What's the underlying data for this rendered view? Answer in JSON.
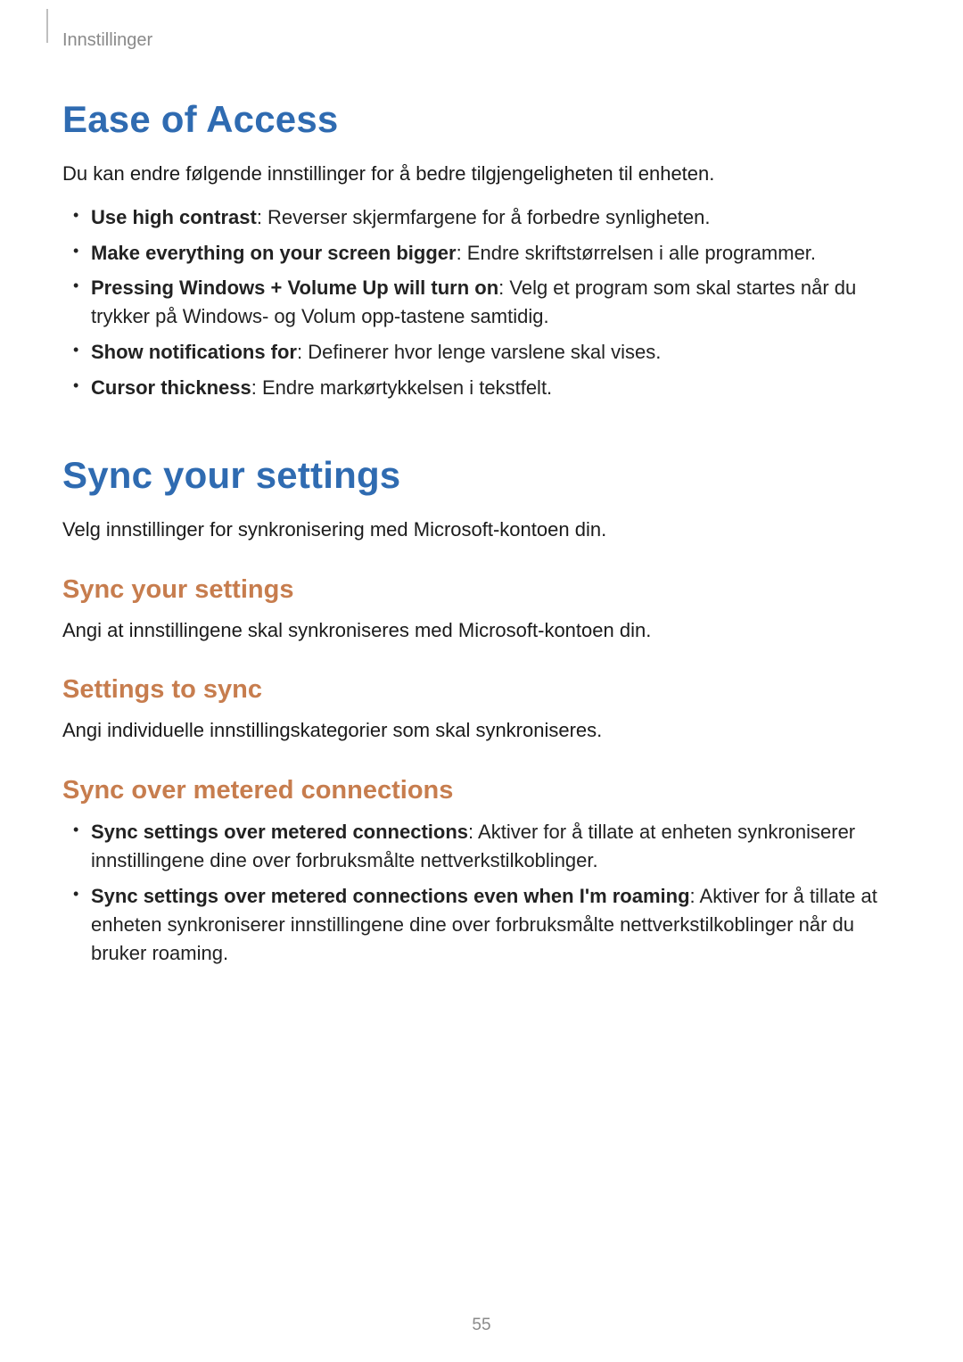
{
  "header": {
    "label": "Innstillinger"
  },
  "section1": {
    "title": "Ease of Access",
    "intro": "Du kan endre følgende innstillinger for å bedre tilgjengeligheten til enheten.",
    "items": [
      {
        "bold": "Use high contrast",
        "rest": ": Reverser skjermfargene for å forbedre synligheten."
      },
      {
        "bold": "Make everything on your screen bigger",
        "rest": ": Endre skriftstørrelsen i alle programmer."
      },
      {
        "bold": "Pressing Windows + Volume Up will turn on",
        "rest": ": Velg et program som skal startes når du trykker på Windows- og Volum opp-tastene samtidig."
      },
      {
        "bold": "Show notifications for",
        "rest": ": Definerer hvor lenge varslene skal vises."
      },
      {
        "bold": "Cursor thickness",
        "rest": ": Endre markørtykkelsen i tekstfelt."
      }
    ]
  },
  "section2": {
    "title": "Sync your settings",
    "intro": "Velg innstillinger for synkronisering med Microsoft-kontoen din.",
    "sub1": {
      "title": "Sync your settings",
      "body": "Angi at innstillingene skal synkroniseres med Microsoft-kontoen din."
    },
    "sub2": {
      "title": "Settings to sync",
      "body": "Angi individuelle innstillingskategorier som skal synkroniseres."
    },
    "sub3": {
      "title": "Sync over metered connections",
      "items": [
        {
          "bold": "Sync settings over metered connections",
          "rest": ": Aktiver for å tillate at enheten synkroniserer innstillingene dine over forbruksmålte nettverkstilkoblinger."
        },
        {
          "bold": "Sync settings over metered connections even when I'm roaming",
          "rest": ": Aktiver for å tillate at enheten synkroniserer innstillingene dine over forbruksmålte nettverkstilkoblinger når du bruker roaming."
        }
      ]
    }
  },
  "pageNumber": "55"
}
